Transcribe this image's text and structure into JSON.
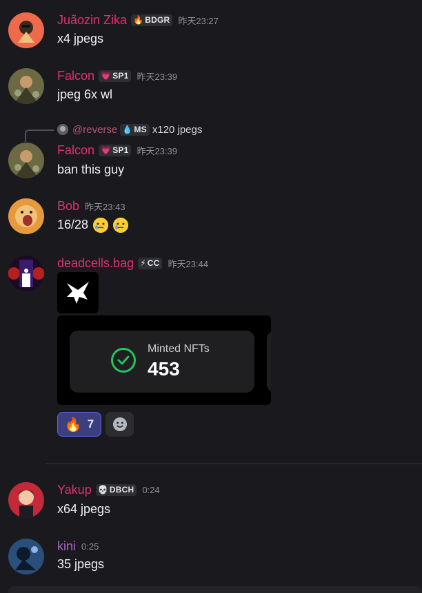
{
  "messages": [
    {
      "user": "Juãozin Zika",
      "tag": "BDGR",
      "tag_icon": "🔥",
      "time": "昨天23:27",
      "text": "x4 jpegs"
    },
    {
      "user": "Falcon",
      "tag": "SP1",
      "tag_icon": "💗",
      "time": "昨天23:39",
      "text": "jpeg 6x wl"
    },
    {
      "user": "Falcon",
      "tag": "SP1",
      "tag_icon": "💗",
      "time": "昨天23:39",
      "text": "ban this guy",
      "reply": {
        "user": "@reverse",
        "tag": "MS",
        "tag_icon": "💧",
        "text": "x120 jpegs"
      }
    },
    {
      "user": "Bob",
      "time": "昨天23:43",
      "text": "16/28"
    },
    {
      "user": "deadcells.bag",
      "tag": "CC",
      "tag_icon": "⚡",
      "time": "昨天23:44",
      "embed": {
        "label": "Minted NFTs",
        "value": "453"
      },
      "reaction": {
        "emoji": "🔥",
        "count": "7"
      }
    },
    {
      "user": "Yakup",
      "tag": "DBCH",
      "tag_icon": "💀",
      "time": "0:24",
      "text": "x64 jpegs"
    },
    {
      "user": "kini",
      "time": "0:25",
      "text": "35 jpegs"
    }
  ],
  "colors": {
    "background": "#1a1a1e",
    "username": "#e0316e",
    "username_alt": "#a865c9",
    "reaction_active": "#3b3f80"
  }
}
